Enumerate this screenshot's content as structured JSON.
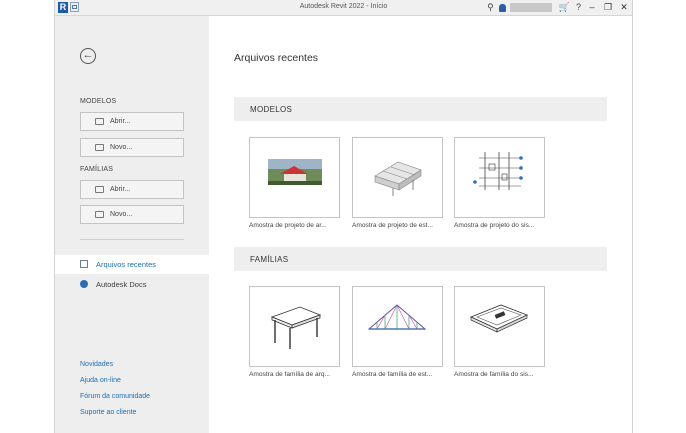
{
  "window": {
    "title": "Autodesk Revit 2022 - Início",
    "app_letter": "R"
  },
  "titlebar": {
    "icons": [
      "binoculars-icon",
      "user-icon",
      "cart-icon",
      "help-icon",
      "minimize-icon",
      "restore-icon",
      "close-icon"
    ],
    "help_glyph": "?"
  },
  "sidebar": {
    "modelos_label": "MODELOS",
    "familias_label": "FAMÍLIAS",
    "modelos_open": "Abrir...",
    "modelos_new": "Novo...",
    "familias_open": "Abrir...",
    "familias_new": "Novo...",
    "nav": {
      "recent": "Arquivos recentes",
      "docs": "Autodesk Docs"
    },
    "links": [
      "Novidades",
      "Ajuda on-line",
      "Fórum da comunidade",
      "Suporte ao cliente"
    ]
  },
  "main": {
    "title": "Arquivos recentes",
    "modelos_band": "MODELOS",
    "familias_band": "FAMÍLIAS",
    "models": [
      "Amostra de projeto de ar...",
      "Amostra de projeto de est...",
      "Amostra de projeto do sis..."
    ],
    "families": [
      "Amostra de família de arq...",
      "Amostra de família de est...",
      "Amostra de família do sis..."
    ]
  },
  "colors": {
    "accent": "#1a6fb7",
    "sidebar_bg": "#eeeeee",
    "band_bg": "#eeeeee"
  }
}
